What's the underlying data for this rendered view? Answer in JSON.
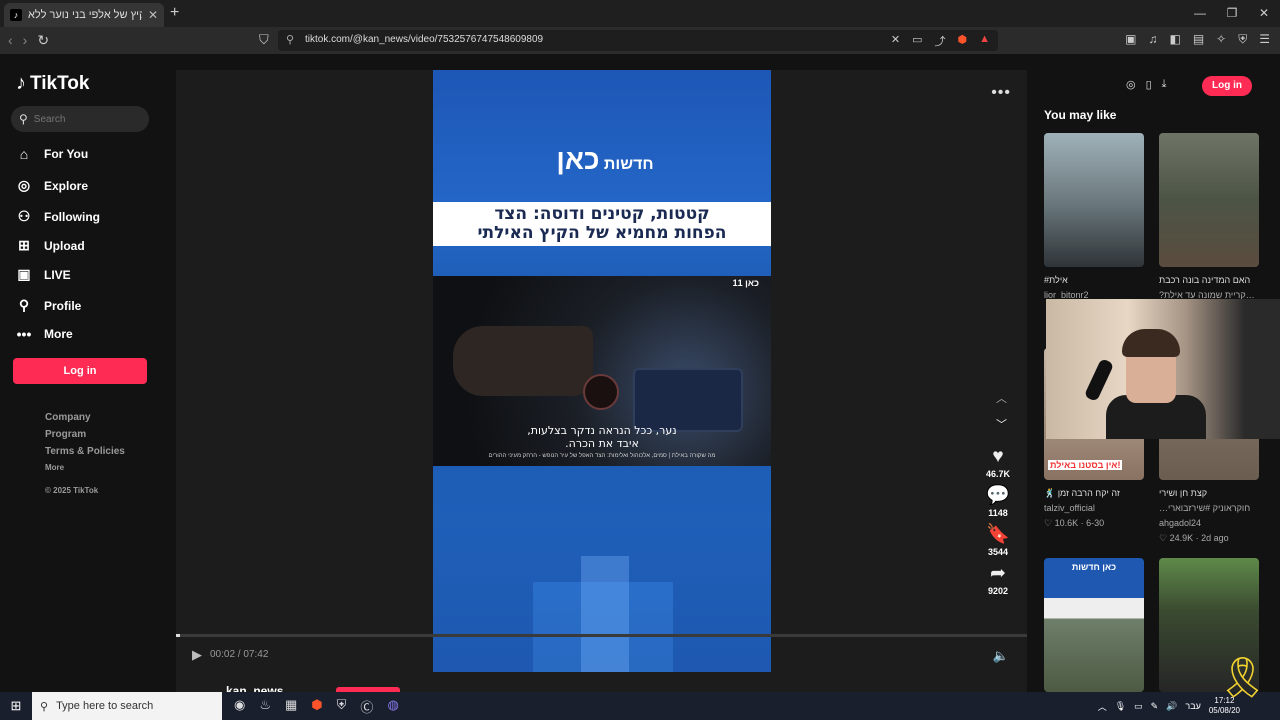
{
  "browser": {
    "tab_title": "אילת: קיץ של אלפי בני נוער ללא",
    "tab_favicon": "tiktok",
    "url": "tiktok.com/@kan_news/video/7532576747548609809"
  },
  "sidebar": {
    "logo": "TikTok",
    "search_placeholder": "Search",
    "nav": [
      {
        "label": "For You",
        "icon": "home-icon"
      },
      {
        "label": "Explore",
        "icon": "compass-icon"
      },
      {
        "label": "Following",
        "icon": "user-icon"
      },
      {
        "label": "Upload",
        "icon": "plus-square-icon"
      },
      {
        "label": "LIVE",
        "icon": "live-tv-icon"
      },
      {
        "label": "Profile",
        "icon": "profile-icon"
      },
      {
        "label": "More",
        "icon": "ellipsis-icon"
      }
    ],
    "login_label": "Log in",
    "footer": [
      "Company",
      "Program",
      "Terms & Policies"
    ],
    "footer_more": "More",
    "copyright": "© 2025 TikTok"
  },
  "video": {
    "brand_small": "חדשות",
    "brand_big": "כאן",
    "headline_line1": "קטטות, קטינים ודוסה: הצד",
    "headline_line2": "הפחות מחמיא של הקיץ האילתי",
    "subtitle_line1": "נער, ככל הנראה נדקר בצלעות,",
    "subtitle_line2": "איבד את הכרה.",
    "ticker": "מה שקורה באילת | סמים, אלכוהול ואלימות: הצד האפל של עיר הנופש - הרחק מעיני ההורים",
    "corner_logo": "כאן 11",
    "likes": "46.7K",
    "comments": "1148",
    "saves": "3544",
    "shares": "9202",
    "time": "00:02 / 07:42",
    "progress_fraction": 0.005,
    "author": "kan_news"
  },
  "right_panel": {
    "login_label": "Log in",
    "heading": "You may like",
    "items": [
      {
        "title": "#אילת",
        "user": "lior_bitonr2",
        "stats": ""
      },
      {
        "title": "האם המדינה בונה רכבת",
        "user": "…קריית שמונה עד אילת?",
        "stats": ""
      },
      {
        "title": "🕺 זה יקח הרבה זמן",
        "user": "talziv_official",
        "stats": "♡ 10.6K · 6-30"
      },
      {
        "title": "קצת חן ושירי",
        "user": "…חוקראוניק #שירזבוארי",
        "stats": "ahgadol24"
      },
      {
        "title": "",
        "user": "",
        "stats": "♡ 24.9K · 2d ago"
      }
    ],
    "thumb3_caption": "אין בסטנו באילת!",
    "thumb5_caption": "כאן חדשות"
  },
  "taskbar": {
    "search_placeholder": "Type here to search",
    "lang": "עבר",
    "time": "17:12",
    "date": "05/08/20"
  }
}
